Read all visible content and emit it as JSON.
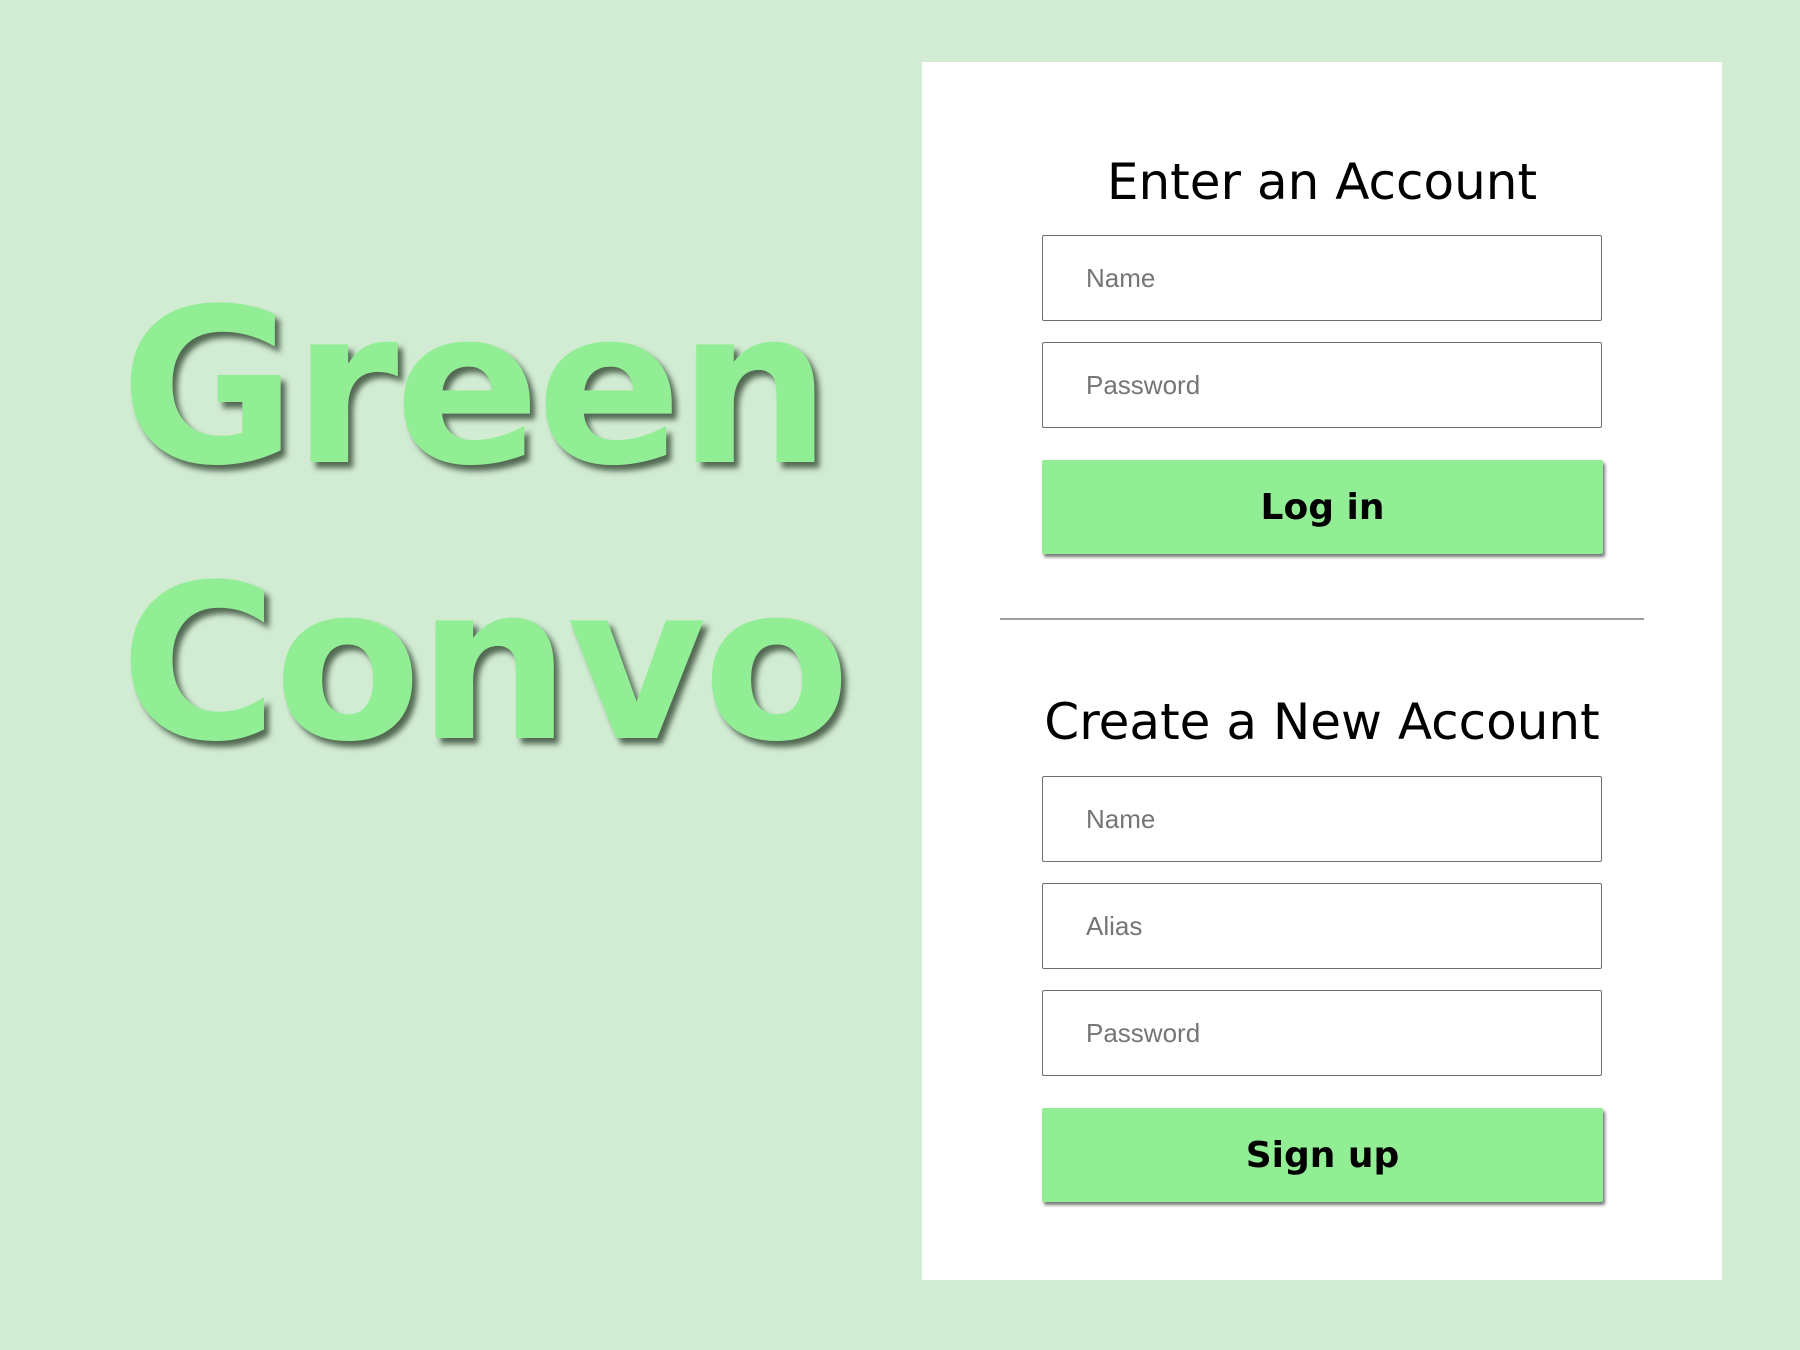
{
  "brand": {
    "line1": "Green",
    "line2": "Convo",
    "color": "#92ee94"
  },
  "login": {
    "heading": "Enter an Account",
    "name_placeholder": "Name",
    "password_placeholder": "Password",
    "submit_label": "Log in"
  },
  "signup": {
    "heading": "Create a New Account",
    "name_placeholder": "Name",
    "alias_placeholder": "Alias",
    "password_placeholder": "Password",
    "submit_label": "Sign up"
  },
  "colors": {
    "background": "#d2ecd4",
    "panel": "#ffffff",
    "accent": "#92ee94"
  }
}
